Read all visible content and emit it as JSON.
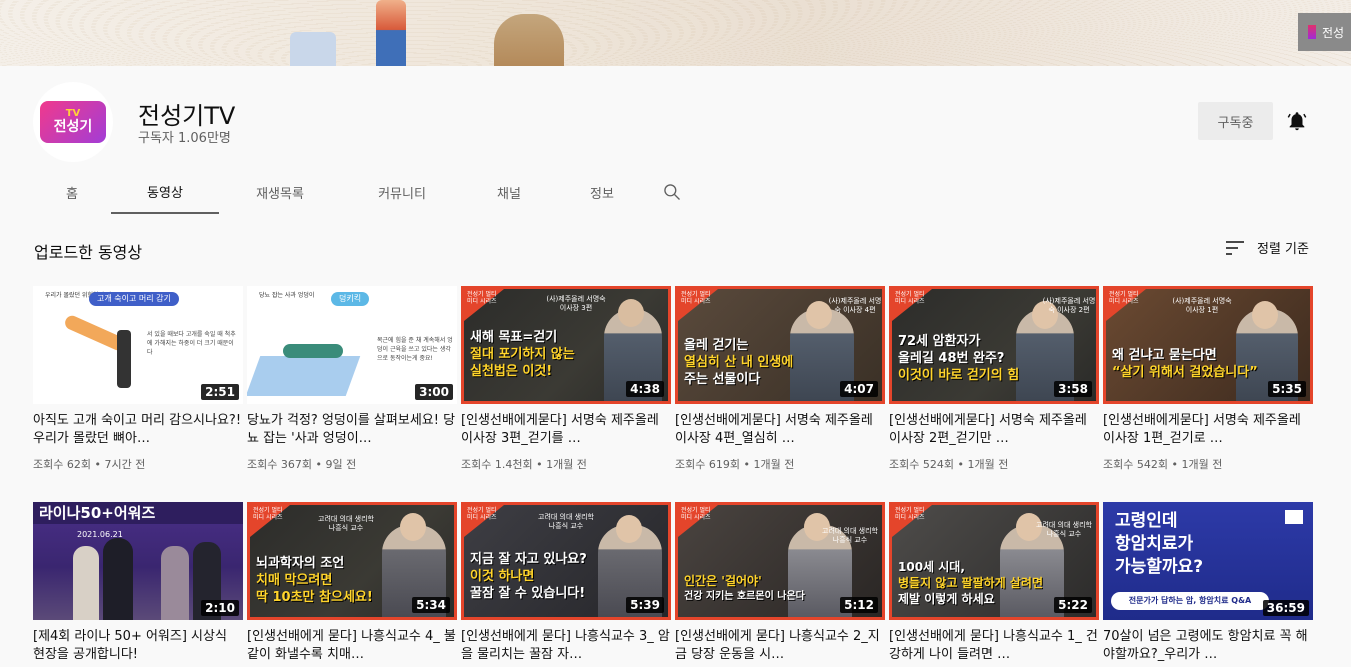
{
  "banner": {
    "brand_text": "전성"
  },
  "channel": {
    "name": "전성기TV",
    "subscribers": "구독자 1.06만명",
    "avatar_tv": "TV",
    "avatar_name": "전성기",
    "subscribe_label": "구독중"
  },
  "tabs": [
    {
      "label": "홈"
    },
    {
      "label": "동영상"
    },
    {
      "label": "재생목록"
    },
    {
      "label": "커뮤니티"
    },
    {
      "label": "채널"
    },
    {
      "label": "정보"
    }
  ],
  "section": {
    "title": "업로드한 동영상",
    "sort_label": "정렬 기준"
  },
  "videos": [
    {
      "title": "아직도 고개 숙이고 머리 감으시나요?! 우리가 몰랐던 뼈아…",
      "meta": "조회수 62회 • 7시간 전",
      "duration": "2:51",
      "thumb": {
        "tag": "고개 숙이고 머리 감기",
        "small": "우리가 몰랐던 위험한 습관들",
        "body": "서 있을 때보다 고개를 숙일 때 척추에 가해지는 하중이 더 크기 때문이다"
      }
    },
    {
      "title": "당뇨가 걱정? 엉덩이를 살펴보세요! 당뇨 잡는 '사과 엉덩이…",
      "meta": "조회수 367회 • 9일 전",
      "duration": "3:00",
      "thumb": {
        "tag": "덩키킥",
        "small": "당뇨 잡는 사과 엉덩이",
        "body": "복근에 힘을 준 채 계속해서 엉덩이 근육을 쓰고 있다는 생각으로 동작이는게 중요!"
      }
    },
    {
      "title": "[인생선배에게묻다] 서명숙 제주올레 이사장 3편_걷기를 …",
      "meta": "조회수 1.4천회 • 1개월 전",
      "duration": "4:38",
      "thumb": {
        "corner": "전성기 멀티미디 시리즈",
        "badge": "(사)제주올레 서명숙 이사장 3편",
        "line1": "새해 목표=걷기",
        "line2": "절대 포기하지 않는",
        "line3": "실천법은 이것!"
      }
    },
    {
      "title": "[인생선배에게묻다] 서명숙 제주올레 이사장 4편_열심히 …",
      "meta": "조회수 619회 • 1개월 전",
      "duration": "4:07",
      "thumb": {
        "corner": "전성기 멀티미디 시리즈",
        "badge": "(사)제주올레 서명숙 이사장 4편",
        "line1": "올레 걷기는",
        "line2": "열심히 산 내 인생에",
        "line3": "주는 선물이다"
      }
    },
    {
      "title": "[인생선배에게묻다] 서명숙 제주올레 이사장 2편_걷기만 …",
      "meta": "조회수 524회 • 1개월 전",
      "duration": "3:58",
      "thumb": {
        "corner": "전성기 멀티미디 시리즈",
        "badge": "(사)제주올레 서명숙 이사장 2편",
        "line1": "72세 암환자가",
        "line2": "올레길 48번 완주?",
        "line3": "이것이 바로 걷기의 힘"
      }
    },
    {
      "title": "[인생선배에게묻다] 서명숙 제주올레 이사장 1편_걷기로 …",
      "meta": "조회수 542회 • 1개월 전",
      "duration": "5:35",
      "thumb": {
        "corner": "전성기 멀티미디 시리즈",
        "badge": "(사)제주올레 서명숙 이사장 1편",
        "line1": "",
        "line2": "왜 걷냐고 묻는다면",
        "line3": "“살기 위해서 걸었습니다”"
      }
    },
    {
      "title": "[제4회 라이나 50+ 어워즈] 시상식 현장을 공개합니다!",
      "meta": "",
      "duration": "2:10",
      "thumb": {
        "band": "라이나50+어워즈",
        "date": "2021.06.21"
      }
    },
    {
      "title": "[인생선배에게 묻다] 나흥식교수 4_ 불같이 화낼수록 치매…",
      "meta": "",
      "duration": "5:34",
      "thumb": {
        "corner": "전성기 멀티미디 시리즈",
        "badge": "고려대 의대 생리학 나흥식 교수",
        "line1": "뇌과학자의 조언",
        "line2": "치매 막으려면",
        "line3": "딱 10초만 참으세요!"
      }
    },
    {
      "title": "[인생선배에게 묻다] 나흥식교수 3_ 암을 물리치는 꿀잠 자…",
      "meta": "",
      "duration": "5:39",
      "thumb": {
        "corner": "전성기 멀티미디 시리즈",
        "badge": "고려대 의대 생리학 나흥식 교수",
        "line1": "지금 잘 자고 있나요?",
        "line2": "이것 하나면",
        "line3": "꿀잠 잘 수 있습니다!"
      }
    },
    {
      "title": "[인생선배에게 묻다] 나흥식교수 2_지금 당장 운동을 시…",
      "meta": "",
      "duration": "5:12",
      "thumb": {
        "corner": "전성기 멀티미디 시리즈",
        "badge": "고려대 의대 생리학 나흥식 교수",
        "line1": "",
        "line2": "인간은 '걸어야'",
        "line3": "건강 지키는 호르몬이 나온다"
      }
    },
    {
      "title": "[인생선배에게 묻다] 나흥식교수 1_ 건강하게 나이 들려면 …",
      "meta": "",
      "duration": "5:22",
      "thumb": {
        "corner": "전성기 멀티미디 시리즈",
        "badge": "고려대 의대 생리학 나흥식 교수",
        "line1": "100세 시대,",
        "line2": "병들지 않고 팔팔하게 살려면",
        "line3": "제발 이렇게 하세요"
      }
    },
    {
      "title": "70살이 넘은 고령에도 항암치료 꼭 해야할까요?_우리가 …",
      "meta": "",
      "duration": "36:59",
      "thumb": {
        "big1": "고령인데",
        "big2": "항암치료가",
        "big3": "가능할까요?",
        "bar": "전문가가 답하는 암, 항암치료 Q&A"
      }
    }
  ],
  "colors": {
    "accent": "#e4452b",
    "active_tab_underline": "#606060",
    "highlight_yellow": "#ffd42b"
  },
  "icons": {
    "bell": "bell-icon",
    "search": "search-icon",
    "sort": "sort-icon"
  }
}
